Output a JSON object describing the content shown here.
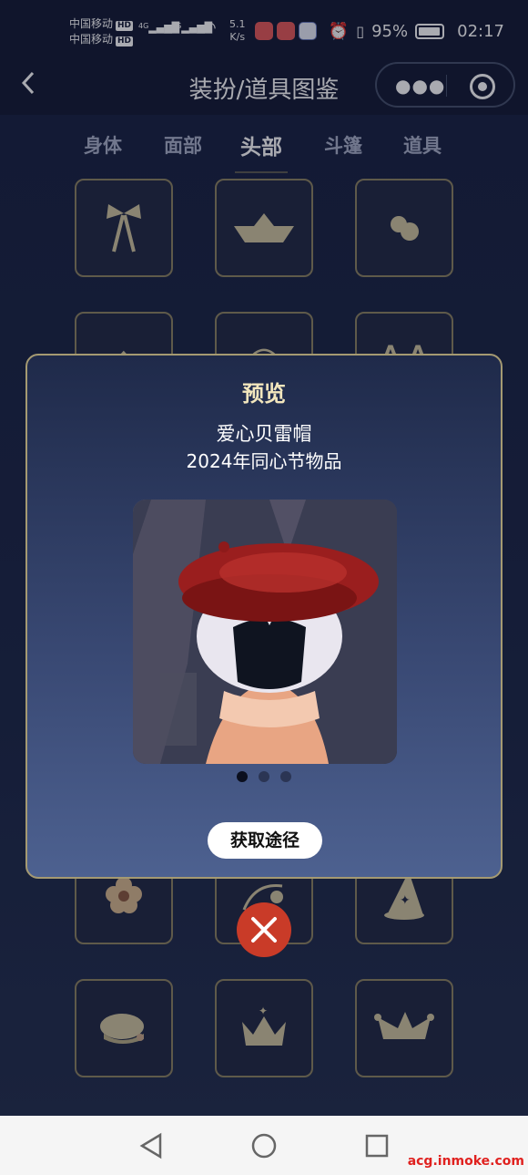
{
  "status": {
    "carrier1": "中国移动",
    "carrier2": "中国移动",
    "hd": "HD",
    "net1": "4G",
    "net2": "4G",
    "speed_value": "5.1",
    "speed_unit": "K/s",
    "battery": "95%",
    "time": "02:17"
  },
  "nav": {
    "title": "装扮/道具图鉴",
    "more_icon": "more-dots-icon",
    "target_icon": "target-icon"
  },
  "tabs": [
    "身体",
    "面部",
    "头部",
    "斗篷",
    "道具"
  ],
  "active_tab": "头部",
  "grid_icons": {
    "row1": [
      "bow-icon",
      "paper-boat-hat-icon",
      "flower-hairpin-icon"
    ],
    "row2": [
      "helmet-icon",
      "circle-hat-icon",
      "cat-ears-icon"
    ],
    "row3": [
      "flower-icon",
      "flower-headband-icon",
      "wizard-hat-icon"
    ],
    "row4": [
      "beret-icon",
      "crown-icon",
      "jester-hat-icon"
    ]
  },
  "modal": {
    "title": "预览",
    "item_name": "爱心贝雷帽",
    "item_desc": "2024年同心节物品",
    "page_dots": 3,
    "active_dot": 1,
    "get_button": "获取途径"
  },
  "watermark": "acg.inmoke.com",
  "colors": {
    "accent_gold": "#a59a72",
    "close_red": "#c93b28",
    "background": "#1a2342"
  }
}
